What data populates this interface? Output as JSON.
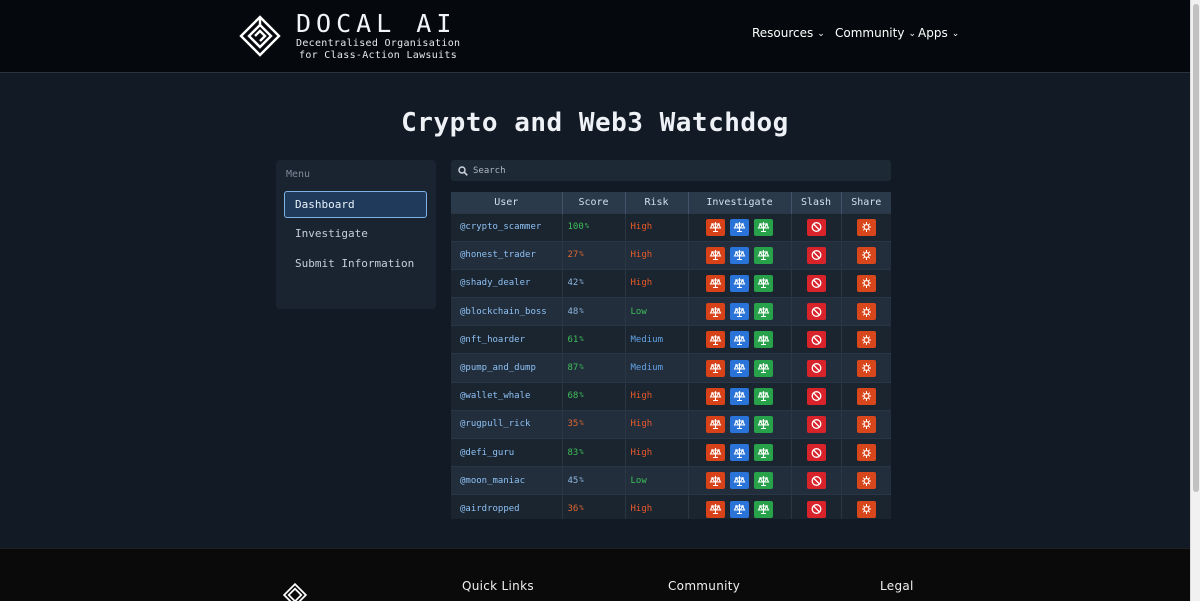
{
  "brand": {
    "title": "DOCAL AI",
    "subtitle_line1": "Decentralised Organisation",
    "subtitle_line2": "for Class-Action Lawsuits"
  },
  "nav": [
    {
      "label": "Resources"
    },
    {
      "label": "Community"
    },
    {
      "label": "Apps"
    }
  ],
  "page": {
    "title": "Crypto and Web3 Watchdog"
  },
  "sidebar": {
    "heading": "Menu",
    "items": [
      {
        "label": "Dashboard",
        "active": true
      },
      {
        "label": "Investigate",
        "active": false
      },
      {
        "label": "Submit Information",
        "active": false
      }
    ]
  },
  "search": {
    "placeholder": "Search",
    "value": ""
  },
  "table": {
    "columns": [
      "User",
      "Score",
      "Risk",
      "Investigate",
      "Slash",
      "Share"
    ],
    "rows": [
      {
        "user": "@crypto_scammer",
        "score": "100",
        "risk": "High"
      },
      {
        "user": "@honest_trader",
        "score": "27",
        "risk": "High"
      },
      {
        "user": "@shady_dealer",
        "score": "42",
        "risk": "High"
      },
      {
        "user": "@blockchain_boss",
        "score": "48",
        "risk": "Low"
      },
      {
        "user": "@nft_hoarder",
        "score": "61",
        "risk": "Medium"
      },
      {
        "user": "@pump_and_dump",
        "score": "87",
        "risk": "Medium"
      },
      {
        "user": "@wallet_whale",
        "score": "68",
        "risk": "High"
      },
      {
        "user": "@rugpull_rick",
        "score": "35",
        "risk": "High"
      },
      {
        "user": "@defi_guru",
        "score": "83",
        "risk": "High"
      },
      {
        "user": "@moon_maniac",
        "score": "45",
        "risk": "Low"
      },
      {
        "user": "@airdropped",
        "score": "36",
        "risk": "High"
      }
    ],
    "score_unit": "%"
  },
  "colors": {
    "score_high": "#3fbf5a",
    "score_mid": "#8fb7e0",
    "score_low": "#e0672e",
    "risk_high": "#e8592a",
    "risk_medium": "#63a3e6",
    "risk_low": "#3fbf5a"
  },
  "footer": {
    "headings": [
      "Quick Links",
      "Community",
      "Legal"
    ]
  }
}
